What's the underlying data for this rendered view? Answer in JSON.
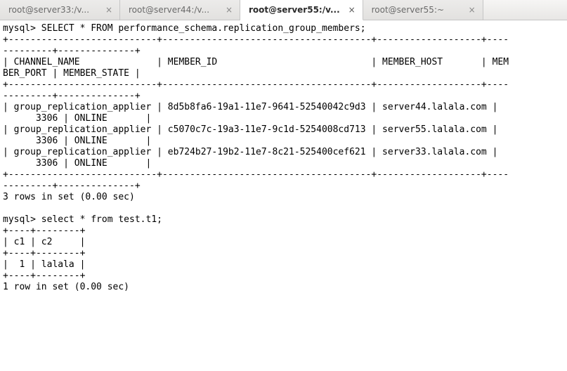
{
  "tabs": [
    {
      "label": "root@server33:/v...",
      "active": false
    },
    {
      "label": "root@server44:/v...",
      "active": false
    },
    {
      "label": "root@server55:/v...",
      "active": true
    },
    {
      "label": "root@server55:~",
      "active": false
    }
  ],
  "terminal": {
    "prompt1": "mysql> SELECT * FROM performance_schema.replication_group_members;",
    "sep_long": "+---------------------------+--------------------------------------+-------------------+-------------+--------------+",
    "hdr": "| CHANNEL_NAME              | MEMBER_ID                            | MEMBER_HOST       | MEMBER_PORT | MEMBER_STATE |",
    "row1": "| group_replication_applier | 8d5b8fa6-19a1-11e7-9641-52540042c9d3 | server44.lalala.com |        3306 | ONLINE       |",
    "row2": "| group_replication_applier | c5070c7c-19a3-11e7-9c1d-5254008cd713 | server55.lalala.com |        3306 | ONLINE       |",
    "row3": "| group_replication_applier | eb724b27-19b2-11e7-8c21-525400cef621 | server33.lalala.com |        3306 | ONLINE       |",
    "rowsmsg1": "3 rows in set (0.00 sec)",
    "blank": "",
    "prompt2": "mysql> select * from test.t1;",
    "sep_short": "+----+--------+",
    "hdr2": "| c1 | c2     |",
    "row_t1": "|  1 | lalala |",
    "rowsmsg2": "1 row in set (0.00 sec)"
  },
  "chart_data": {
    "type": "table",
    "tables": [
      {
        "query": "SELECT * FROM performance_schema.replication_group_members",
        "columns": [
          "CHANNEL_NAME",
          "MEMBER_ID",
          "MEMBER_HOST",
          "MEMBER_PORT",
          "MEMBER_STATE"
        ],
        "rows": [
          [
            "group_replication_applier",
            "8d5b8fa6-19a1-11e7-9641-52540042c9d3",
            "server44.lalala.com",
            3306,
            "ONLINE"
          ],
          [
            "group_replication_applier",
            "c5070c7c-19a3-11e7-9c1d-5254008cd713",
            "server55.lalala.com",
            3306,
            "ONLINE"
          ],
          [
            "group_replication_applier",
            "eb724b27-19b2-11e7-8c21-525400cef621",
            "server33.lalala.com",
            3306,
            "ONLINE"
          ]
        ],
        "rows_in_set": 3,
        "time_sec": 0.0
      },
      {
        "query": "select * from test.t1",
        "columns": [
          "c1",
          "c2"
        ],
        "rows": [
          [
            1,
            "lalala"
          ]
        ],
        "rows_in_set": 1,
        "time_sec": 0.0
      }
    ]
  }
}
